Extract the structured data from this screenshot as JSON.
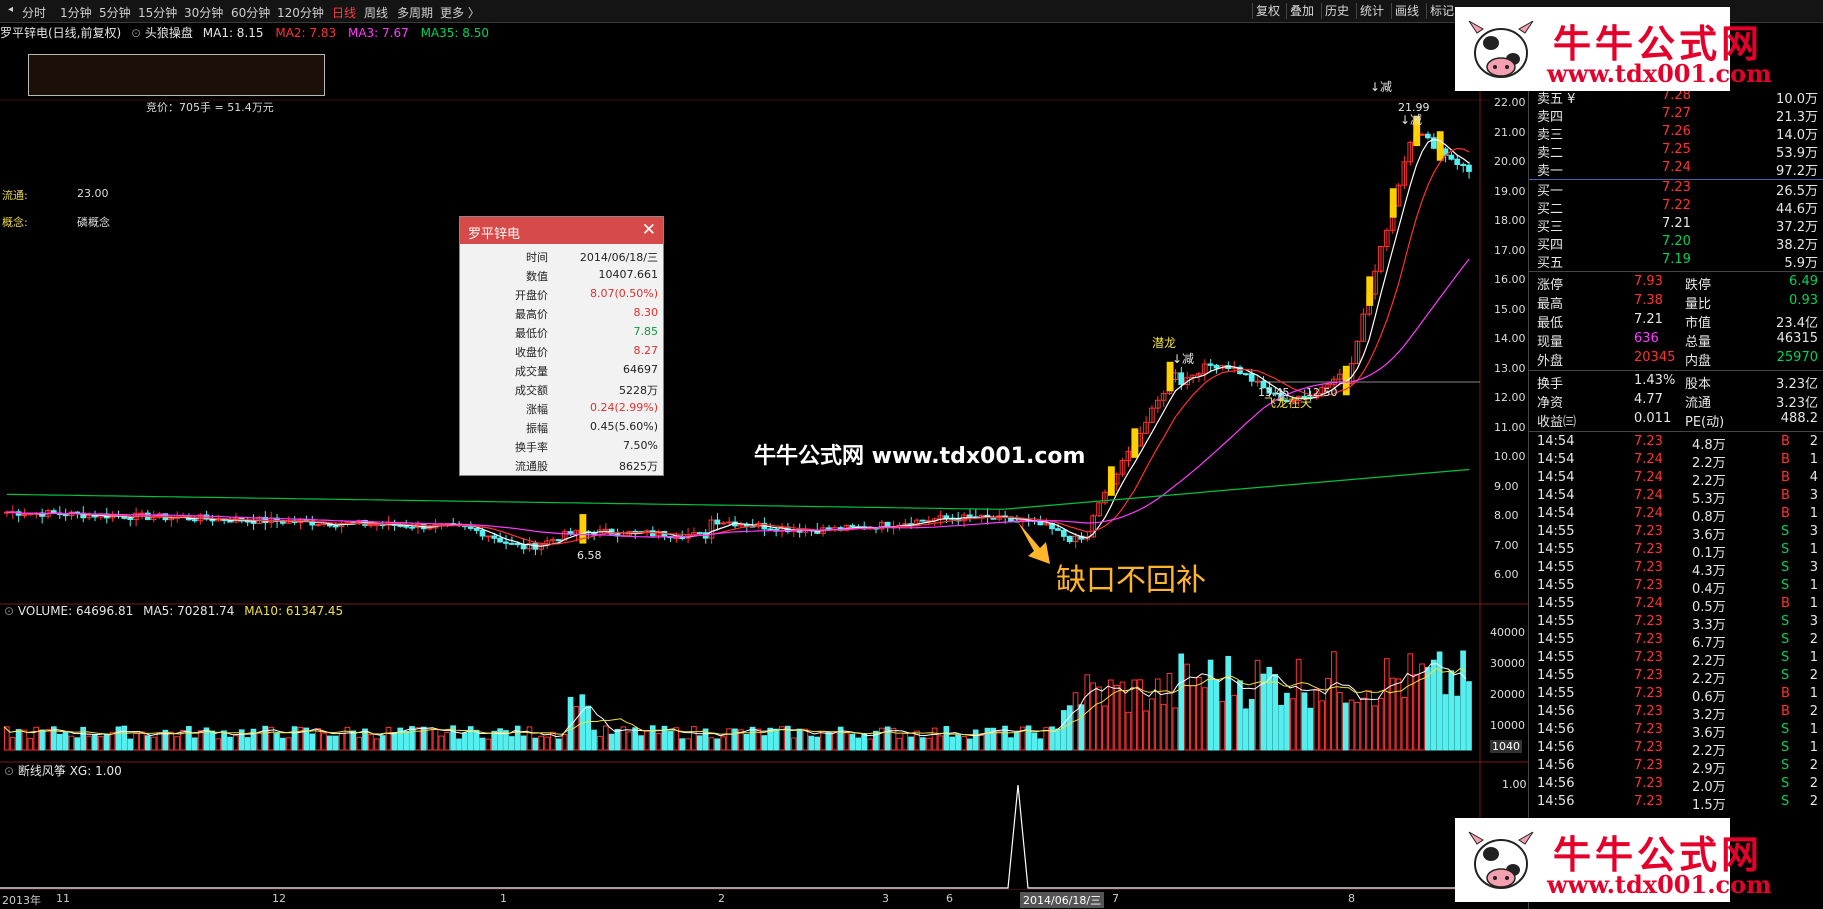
{
  "toolbar": {
    "periods": [
      "分时",
      "1分钟",
      "5分钟",
      "15分钟",
      "30分钟",
      "60分钟",
      "120分钟",
      "日线",
      "周线",
      "多周期",
      "更多 〉"
    ],
    "active_period": "日线",
    "right_buttons": [
      "复权",
      "叠加",
      "历史",
      "统计",
      "画线",
      "标记"
    ]
  },
  "title_line": {
    "stock": "罗平锌电(日线,前复权)",
    "indicator": "头狼操盘",
    "ma1": "MA1: 8.15",
    "ma2": "MA2: 7.83",
    "ma3": "MA3: 7.67",
    "ma35": "MA35: 8.50"
  },
  "auction": "竞价：705手 = 51.4万元",
  "side_info": {
    "float_label": "流通:",
    "float_value": "23.00",
    "concept_label": "概念:",
    "concept_value": "磷概念"
  },
  "popup": {
    "title": "罗平锌电",
    "rows": [
      {
        "label": "时间",
        "value": "2014/06/18/三",
        "color": "#222222"
      },
      {
        "label": "数值",
        "value": "10407.661",
        "color": "#222222"
      },
      {
        "label": "开盘价",
        "value": "8.07(0.50%)",
        "color": "#e03030"
      },
      {
        "label": "最高价",
        "value": "8.30",
        "color": "#e03030"
      },
      {
        "label": "最低价",
        "value": "7.85",
        "color": "#0a9a3a"
      },
      {
        "label": "收盘价",
        "value": "8.27",
        "color": "#e03030"
      },
      {
        "label": "成交量",
        "value": "64697",
        "color": "#222222"
      },
      {
        "label": "成交额",
        "value": "5228万",
        "color": "#222222"
      },
      {
        "label": "涨幅",
        "value": "0.24(2.99%)",
        "color": "#e03030"
      },
      {
        "label": "振幅",
        "value": "0.45(5.60%)",
        "color": "#222222"
      },
      {
        "label": "换手率",
        "value": "7.50%",
        "color": "#222222"
      },
      {
        "label": "流通股",
        "value": "8625万",
        "color": "#222222"
      }
    ]
  },
  "watermark": "牛牛公式网  www.tdx001.com",
  "annotation_gap": "缺口不回补",
  "annotations": {
    "qianlong": "潜龙",
    "jianjian": "↓减",
    "jianjian2": "↓减",
    "jianjian3": "↓减",
    "low_label": "6.58",
    "high_label": "21.99",
    "mid_label": "13.45",
    "mid_label2": "12.50",
    "feilong": "飞龙在天"
  },
  "price_axis": [
    "22.00",
    "21.00",
    "20.00",
    "19.00",
    "18.00",
    "17.00",
    "16.00",
    "15.00",
    "14.00",
    "13.00",
    "12.00",
    "11.00",
    "10.00",
    "9.00",
    "8.00",
    "7.00",
    "6.00"
  ],
  "volume_legend": {
    "name": "VOLUME: 64696.81",
    "ma5": "MA5: 70281.74",
    "ma10": "MA10: 61347.45"
  },
  "volume_axis": [
    "40000",
    "30000",
    "20000",
    "10000"
  ],
  "volume_current": "1040",
  "xg_legend": "断线风筝 XG: 1.00",
  "xg_axis": "1.00",
  "x_axis": [
    "2013年",
    "11",
    "12",
    "1",
    "2",
    "3",
    "6",
    "2014/06/18/三",
    "7",
    "8"
  ],
  "ads": {
    "line1": "牛牛公式网",
    "line2": "www.tdx001.com"
  },
  "quote": {
    "asks": [
      {
        "label": "卖五 ¥",
        "price": "7.28",
        "vol": "10.0万"
      },
      {
        "label": "卖四",
        "price": "7.27",
        "vol": "21.3万"
      },
      {
        "label": "卖三",
        "price": "7.26",
        "vol": "14.0万"
      },
      {
        "label": "卖二",
        "price": "7.25",
        "vol": "53.9万"
      },
      {
        "label": "卖一",
        "price": "7.24",
        "vol": "97.2万"
      }
    ],
    "bids": [
      {
        "label": "买一",
        "price": "7.23",
        "vol": "26.5万",
        "color": "#ff3333"
      },
      {
        "label": "买二",
        "price": "7.22",
        "vol": "44.6万",
        "color": "#ff3333"
      },
      {
        "label": "买三",
        "price": "7.21",
        "vol": "37.2万",
        "color": "#e6e6e6"
      },
      {
        "label": "买四",
        "price": "7.20",
        "vol": "38.2万",
        "color": "#00d35a"
      },
      {
        "label": "买五",
        "price": "7.19",
        "vol": "5.9万",
        "color": "#00d35a"
      }
    ],
    "stats": [
      {
        "l1": "涨停",
        "v1": "7.93",
        "c1": "#ff3333",
        "l2": "跌停",
        "v2": "6.49",
        "c2": "#00d35a"
      },
      {
        "l1": "最高",
        "v1": "7.38",
        "c1": "#ff3333",
        "l2": "量比",
        "v2": "0.93",
        "c2": "#00d35a"
      },
      {
        "l1": "最低",
        "v1": "7.21",
        "c1": "#e6e6e6",
        "l2": "市值",
        "v2": "23.4亿",
        "c2": "#e6e6e6"
      },
      {
        "l1": "现量",
        "v1": "636",
        "c1": "#ff3bff",
        "l2": "总量",
        "v2": "46315",
        "c2": "#e6e6e6"
      },
      {
        "l1": "外盘",
        "v1": "20345",
        "c1": "#ff3333",
        "l2": "内盘",
        "v2": "25970",
        "c2": "#00d35a"
      }
    ],
    "fund": [
      {
        "l1": "换手",
        "v1": "1.43%",
        "l2": "股本",
        "v2": "3.23亿"
      },
      {
        "l1": "净资",
        "v1": "4.77",
        "l2": "流通",
        "v2": "3.23亿"
      },
      {
        "l1": "收益㈢",
        "v1": "0.011",
        "l2": "PE(动)",
        "v2": "488.2"
      }
    ],
    "ticks": [
      {
        "t": "14:54",
        "p": "7.23",
        "v": "4.8万",
        "d": "B",
        "n": "2"
      },
      {
        "t": "14:54",
        "p": "7.24",
        "v": "2.2万",
        "d": "B",
        "n": "1"
      },
      {
        "t": "14:54",
        "p": "7.24",
        "v": "2.2万",
        "d": "B",
        "n": "4"
      },
      {
        "t": "14:54",
        "p": "7.24",
        "v": "5.3万",
        "d": "B",
        "n": "3"
      },
      {
        "t": "14:54",
        "p": "7.24",
        "v": "0.8万",
        "d": "B",
        "n": "1"
      },
      {
        "t": "14:55",
        "p": "7.23",
        "v": "3.6万",
        "d": "S",
        "n": "3"
      },
      {
        "t": "14:55",
        "p": "7.23",
        "v": "0.1万",
        "d": "S",
        "n": "1"
      },
      {
        "t": "14:55",
        "p": "7.23",
        "v": "4.3万",
        "d": "S",
        "n": "3"
      },
      {
        "t": "14:55",
        "p": "7.23",
        "v": "0.4万",
        "d": "S",
        "n": "1"
      },
      {
        "t": "14:55",
        "p": "7.24",
        "v": "0.5万",
        "d": "B",
        "n": "1"
      },
      {
        "t": "14:55",
        "p": "7.23",
        "v": "3.3万",
        "d": "S",
        "n": "3"
      },
      {
        "t": "14:55",
        "p": "7.23",
        "v": "6.7万",
        "d": "S",
        "n": "2"
      },
      {
        "t": "14:55",
        "p": "7.23",
        "v": "2.2万",
        "d": "S",
        "n": "1"
      },
      {
        "t": "14:55",
        "p": "7.23",
        "v": "2.2万",
        "d": "S",
        "n": "2"
      },
      {
        "t": "14:55",
        "p": "7.23",
        "v": "0.6万",
        "d": "B",
        "n": "1"
      },
      {
        "t": "14:56",
        "p": "7.23",
        "v": "3.2万",
        "d": "B",
        "n": "2"
      },
      {
        "t": "14:56",
        "p": "7.23",
        "v": "3.6万",
        "d": "S",
        "n": "1"
      },
      {
        "t": "14:56",
        "p": "7.23",
        "v": "2.2万",
        "d": "S",
        "n": "1"
      },
      {
        "t": "14:56",
        "p": "7.23",
        "v": "2.9万",
        "d": "S",
        "n": "2"
      },
      {
        "t": "14:56",
        "p": "7.23",
        "v": "2.0万",
        "d": "S",
        "n": "2"
      },
      {
        "t": "14:56",
        "p": "7.23",
        "v": "1.5万",
        "d": "S",
        "n": "2"
      }
    ]
  },
  "colors": {
    "up": "#ff3333",
    "down": "#54f0f0",
    "ma1": "#ffffff",
    "ma2": "#ff3030",
    "ma3": "#ff3bff",
    "ma35": "#00c040",
    "signal": "#ffd000"
  }
}
